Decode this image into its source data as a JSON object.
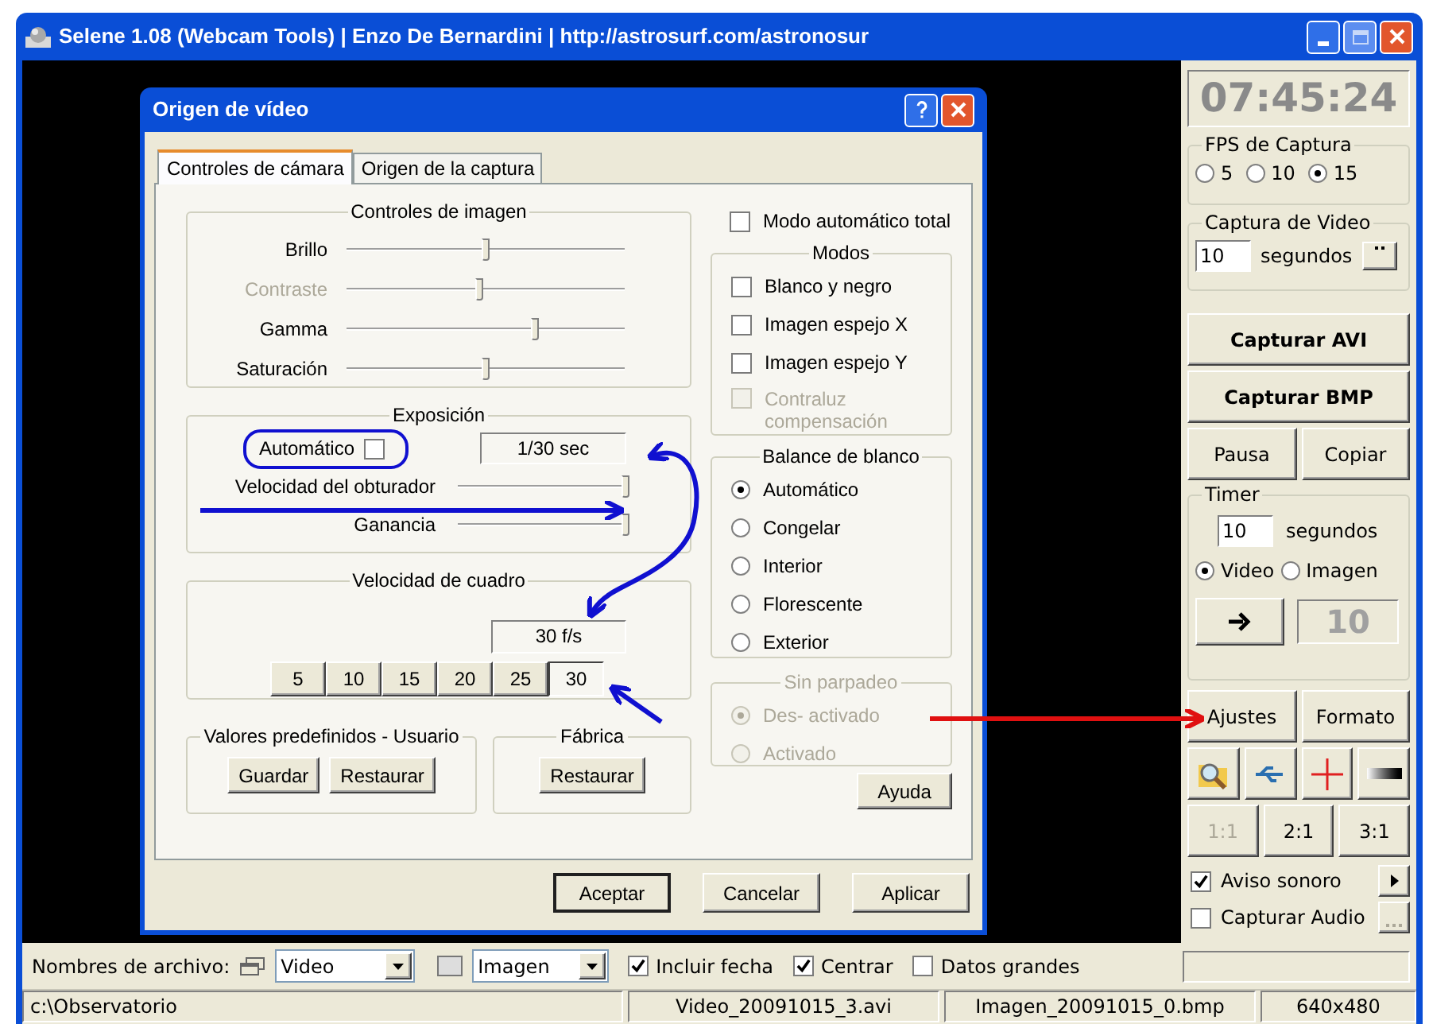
{
  "window": {
    "title": "Selene 1.08 (Webcam Tools) | Enzo De Bernardini | http://astrosurf.com/astronosur"
  },
  "dialog": {
    "title": "Origen de vídeo",
    "tabs": [
      {
        "label": "Controles de cámara",
        "selected": true
      },
      {
        "label": "Origen de la captura",
        "selected": false
      }
    ],
    "image_controls": {
      "title": "Controles de imagen",
      "sliders": [
        {
          "label": "Brillo",
          "level": 0.5,
          "disabled": false
        },
        {
          "label": "Contraste",
          "level": 0.48,
          "disabled": true
        },
        {
          "label": "Gamma",
          "level": 0.68,
          "disabled": false
        },
        {
          "label": "Saturación",
          "level": 0.5,
          "disabled": false
        }
      ]
    },
    "exposure": {
      "title": "Exposición",
      "auto": {
        "label": "Automático",
        "checked": false
      },
      "reading": "1/30 sec",
      "sliders": [
        {
          "label": "Velocidad del obturador",
          "level": 0.98
        },
        {
          "label": "Ganancia",
          "level": 0.98
        }
      ]
    },
    "frame_rate": {
      "title": "Velocidad de cuadro",
      "reading": "30 f/s",
      "options": [
        {
          "label": "5",
          "selected": false
        },
        {
          "label": "10",
          "selected": false
        },
        {
          "label": "15",
          "selected": false
        },
        {
          "label": "20",
          "selected": false
        },
        {
          "label": "25",
          "selected": false
        },
        {
          "label": "30",
          "selected": true
        }
      ]
    },
    "user_presets": {
      "title": "Valores predefinidos - Usuario",
      "buttons": [
        "Guardar",
        "Restaurar"
      ]
    },
    "factory": {
      "title": "Fábrica",
      "buttons": [
        "Restaurar"
      ]
    },
    "auto_total": {
      "label": "Modo automático total",
      "checked": false
    },
    "modes": {
      "title": "Modos",
      "options": [
        {
          "label": "Blanco y negro",
          "checked": false,
          "disabled": false
        },
        {
          "label": "Imagen espejo X",
          "checked": false,
          "disabled": false
        },
        {
          "label": "Imagen espejo Y",
          "checked": false,
          "disabled": false
        },
        {
          "label": "Contraluz compensación",
          "checked": false,
          "disabled": true
        }
      ]
    },
    "white_balance": {
      "title": "Balance de blanco",
      "options": [
        {
          "label": "Automático",
          "selected": true
        },
        {
          "label": "Congelar",
          "selected": false
        },
        {
          "label": "Interior",
          "selected": false
        },
        {
          "label": "Florescente",
          "selected": false
        },
        {
          "label": "Exterior",
          "selected": false
        }
      ]
    },
    "flicker": {
      "title": "Sin parpadeo",
      "disabled": true,
      "options": [
        {
          "label": "Des- activado",
          "selected": true
        },
        {
          "label": "Activado",
          "selected": false
        }
      ]
    },
    "help_button": "Ayuda",
    "buttons": [
      {
        "label": "Aceptar",
        "default": true
      },
      {
        "label": "Cancelar",
        "default": false
      },
      {
        "label": "Aplicar",
        "default": false
      }
    ]
  },
  "side_panel": {
    "clock": "07:45:24",
    "fps": {
      "title": "FPS de Captura",
      "options": [
        {
          "label": "5",
          "selected": false
        },
        {
          "label": "10",
          "selected": false
        },
        {
          "label": "15",
          "selected": true
        }
      ]
    },
    "video_capture": {
      "title": "Captura de Video",
      "value": "10",
      "unit": "segundos"
    },
    "capture_avi": "Capturar AVI",
    "capture_bmp": "Capturar BMP",
    "pause": "Pausa",
    "copy": "Copiar",
    "timer": {
      "title": "Timer",
      "value": "10",
      "unit": "segundos",
      "modes": [
        {
          "label": "Video",
          "selected": true
        },
        {
          "label": "Imagen",
          "selected": false
        }
      ],
      "count": "10"
    },
    "settings": "Ajustes",
    "format": "Formato",
    "zoom": [
      {
        "label": "1:1",
        "disabled": true
      },
      {
        "label": "2:1",
        "disabled": false
      },
      {
        "label": "3:1",
        "disabled": false
      }
    ],
    "sound_alert": {
      "label": "Aviso sonoro",
      "checked": true
    },
    "capture_audio": {
      "label": "Capturar Audio",
      "checked": false
    }
  },
  "file_bar": {
    "label": "Nombres de archivo:",
    "video": "Video",
    "image": "Imagen",
    "options": [
      {
        "label": "Incluir fecha",
        "checked": true
      },
      {
        "label": "Centrar",
        "checked": true
      },
      {
        "label": "Datos grandes",
        "checked": false
      }
    ]
  },
  "status_bar": [
    "c:\\Observatorio",
    "Video_20091015_3.avi",
    "Imagen_20091015_0.bmp",
    "640x480"
  ]
}
